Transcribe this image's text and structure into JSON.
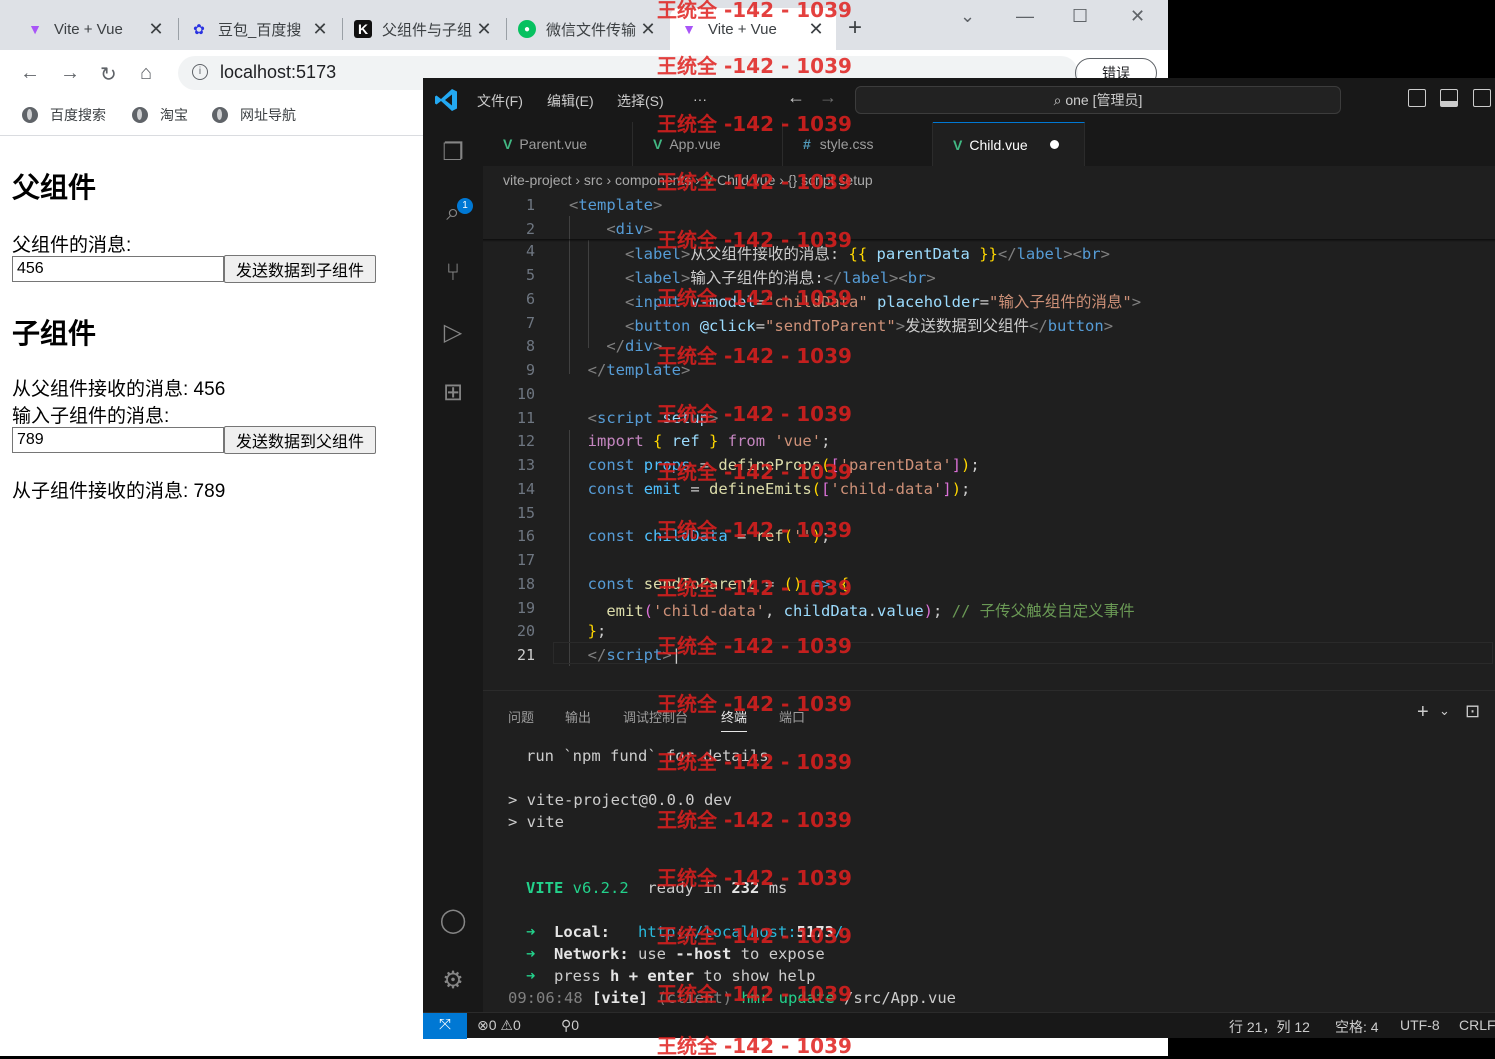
{
  "browser": {
    "tabs": [
      {
        "title": "Vite + Vue",
        "icon": "vite-icon"
      },
      {
        "title": "豆包_百度搜",
        "icon": "baidu-icon"
      },
      {
        "title": "父组件与子组",
        "icon": "k-icon"
      },
      {
        "title": "微信文件传输",
        "icon": "wechat-icon"
      },
      {
        "title": "Vite + Vue",
        "icon": "vite-icon"
      }
    ],
    "url": "localhost:5173",
    "error_button": "错误",
    "bookmarks": [
      "百度搜索",
      "淘宝",
      "网址导航"
    ]
  },
  "page": {
    "parent_heading": "父组件",
    "parent_msg_label": "父组件的消息:",
    "parent_input_value": "456",
    "parent_button": "发送数据到子组件",
    "child_heading": "子组件",
    "child_received": "从父组件接收的消息: 456",
    "child_input_label": "输入子组件的消息:",
    "child_input_value": "789",
    "child_button": "发送数据到父组件",
    "parent_received": "从子组件接收的消息: 789"
  },
  "vscode": {
    "menus": [
      "文件(F)",
      "编辑(E)",
      "选择(S)",
      "···"
    ],
    "search": "one [管理员]",
    "explorer_badge": "1",
    "tabs": [
      {
        "label": "Parent.vue",
        "kind": "vue"
      },
      {
        "label": "App.vue",
        "kind": "vue"
      },
      {
        "label": "style.css",
        "kind": "css"
      },
      {
        "label": "Child.vue",
        "kind": "vue",
        "active": true,
        "modified": true
      }
    ],
    "breadcrumb": [
      "vite-project",
      "src",
      "components",
      "Child.vue",
      "{} script setup"
    ],
    "line_numbers": [
      "1",
      "2",
      "4",
      "5",
      "6",
      "7",
      "8",
      "9",
      "10",
      "11",
      "12",
      "13",
      "14",
      "15",
      "16",
      "17",
      "18",
      "19",
      "20",
      "21"
    ],
    "panel_tabs": [
      "问题",
      "输出",
      "调试控制台",
      "终端",
      "端口"
    ],
    "terminal": {
      "line1": "run `npm fund` for details",
      "line2": "> vite-project@0.0.0 dev",
      "line3": "> vite",
      "vite": "VITE",
      "vite_version": "v6.2.2",
      "ready": "ready in",
      "ready_ms": "232",
      "ms": "ms",
      "local_label": "Local:",
      "local_url_a": "http://localhost:",
      "local_url_port": "5173",
      "local_url_b": "/",
      "network_label": "Network:",
      "network_a": "use",
      "network_host": "--host",
      "network_b": "to expose",
      "press": "press",
      "press_h": "h",
      "plus": "+",
      "enter": "enter",
      "show_help": "to show help",
      "time": "09:06:48",
      "vite_tag": "[vite]",
      "client": "(client)",
      "hmr": "hmr update",
      "path": "/src/App.vue"
    },
    "status": {
      "errors": "0",
      "warnings": "0",
      "ports": "0",
      "position": "行 21，列 12",
      "spaces": "空格: 4",
      "encoding": "UTF-8",
      "eol": "CRLF"
    }
  },
  "watermark": "王统全 -142 - 1039",
  "colors": {
    "vscode_bg": "#1f1f1f",
    "vue_green": "#41b883",
    "accent_blue": "#0078d4",
    "watermark_red": "#e0201e"
  }
}
